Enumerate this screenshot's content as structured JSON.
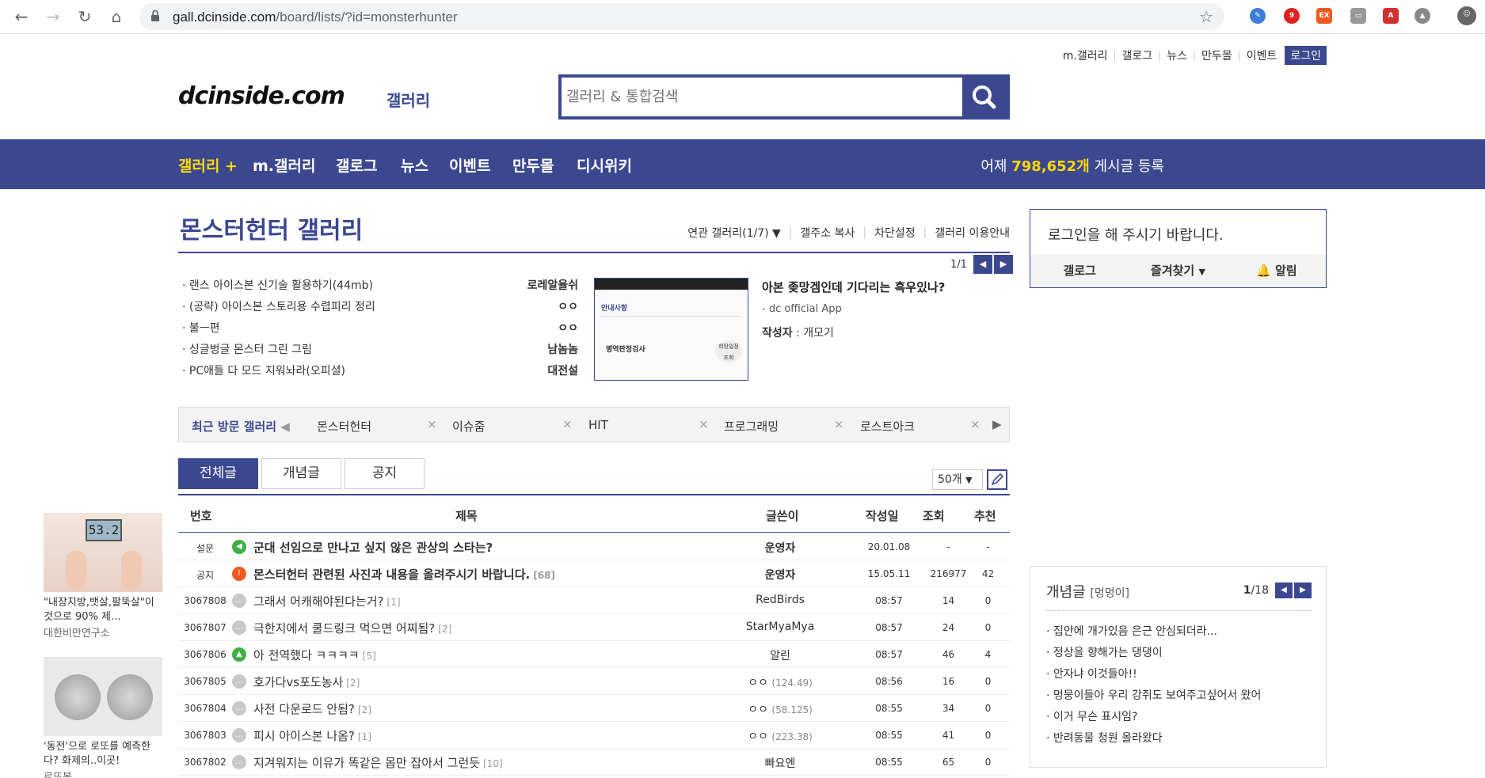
{
  "browser": {
    "url_host": "gall.dcinside.com",
    "url_path": "/board/lists/?id=monsterhunter",
    "ext_badge": "9",
    "ext_ex": "EX"
  },
  "toplinks": [
    "m.갤러리",
    "갤로그",
    "뉴스",
    "만두몰",
    "이벤트"
  ],
  "login_label": "로그인",
  "logo": "dcinside.com",
  "logo_sub": "갤러리",
  "search": {
    "placeholder": "갤러리 & 통합검색"
  },
  "nav": {
    "items": [
      "갤러리 +",
      "m.갤러리",
      "갤로그",
      "뉴스",
      "이벤트",
      "만두몰",
      "디시위키"
    ],
    "stat_prefix": "어제",
    "stat_count": "798,652개",
    "stat_suffix": "게시글 등록"
  },
  "gallery": {
    "title": "몬스터헌터 갤러리",
    "menu": [
      "연관 갤러리(1/7)",
      "갤주소 복사",
      "차단설정",
      "갤러리 이용안내"
    ],
    "page": "1/1"
  },
  "issues": [
    {
      "title": "랜스 아이스본 신기술 활용하기(44mb)",
      "writer": "로레알율쉬"
    },
    {
      "title": "(공략) 아이스본 스토리용 수렵피리 정리",
      "writer": "ㅇㅇ"
    },
    {
      "title": "불ㅡ편",
      "writer": "ㅇㅇ"
    },
    {
      "title": "싱글벙글 몬스터 그린 그림",
      "writer": "남놈놈"
    },
    {
      "title": "PC애들 다 모드 지워놔라(오피셜)",
      "writer": "대전설"
    }
  ],
  "issue_feature": {
    "title": "아본 좆망겜인데 기다리는 흑우있나?",
    "source": "- dc official App",
    "author_label": "작성자",
    "author": "개모기",
    "thumb_notice": "안내사항",
    "thumb_item": "병역판정검사",
    "thumb_btn": "희망일정 조회"
  },
  "recent": {
    "label": "최근 방문 갤러리",
    "galleries": [
      "몬스터헌터",
      "이슈줌",
      "HIT",
      "프로그래밍",
      "로스트아크"
    ]
  },
  "tabs": [
    "전체글",
    "개념글",
    "공지"
  ],
  "per_page": "50개",
  "table": {
    "headers": [
      "번호",
      "제목",
      "글쓴이",
      "작성일",
      "조회",
      "추천"
    ],
    "rows": [
      {
        "num": "설문",
        "title": "군대 선임으로 만나고 싶지 않은 관상의 스타는?",
        "reply": "",
        "writer": "운영자",
        "ip": "",
        "date": "20.01.08",
        "views": "-",
        "rec": "-",
        "icon": "survey",
        "notice": true
      },
      {
        "num": "공지",
        "title": "몬스터헌터 관련된 사진과 내용을 올려주시기 바랍니다.",
        "reply": "[68]",
        "writer": "운영자",
        "ip": "",
        "date": "15.05.11",
        "views": "216977",
        "rec": "42",
        "icon": "notice",
        "notice": true
      },
      {
        "num": "3067808",
        "title": "그래서 어캐해야된다는거?",
        "reply": "[1]",
        "writer": "RedBirds",
        "ip": "",
        "date": "08:57",
        "views": "14",
        "rec": "0",
        "icon": "chat",
        "notice": false
      },
      {
        "num": "3067807",
        "title": "극한지에서 쿨드링크 먹으면 어찌됨?",
        "reply": "[2]",
        "writer": "StarMyaMya",
        "ip": "",
        "date": "08:57",
        "views": "24",
        "rec": "0",
        "icon": "chat",
        "notice": false
      },
      {
        "num": "3067806",
        "title": "아 전역했다 ㅋㅋㅋㅋ",
        "reply": "[5]",
        "writer": "알린",
        "ip": "",
        "date": "08:57",
        "views": "46",
        "rec": "4",
        "icon": "image",
        "notice": false
      },
      {
        "num": "3067805",
        "title": "호가다vs포도농사",
        "reply": "[2]",
        "writer": "ㅇㅇ",
        "ip": "(124.49)",
        "date": "08:56",
        "views": "16",
        "rec": "0",
        "icon": "chat",
        "notice": false
      },
      {
        "num": "3067804",
        "title": "사전 다운로드 안됨?",
        "reply": "[2]",
        "writer": "ㅇㅇ",
        "ip": "(58.125)",
        "date": "08:55",
        "views": "34",
        "rec": "0",
        "icon": "chat",
        "notice": false
      },
      {
        "num": "3067803",
        "title": "피시 아이스본 나옴?",
        "reply": "[1]",
        "writer": "ㅇㅇ",
        "ip": "(223.38)",
        "date": "08:55",
        "views": "41",
        "rec": "0",
        "icon": "chat",
        "notice": false
      },
      {
        "num": "3067802",
        "title": "지겨워지는 이유가 똑같은 몹만 잡아서 그런듯",
        "reply": "[10]",
        "writer": "빠요엔",
        "ip": "",
        "date": "08:55",
        "views": "65",
        "rec": "0",
        "icon": "chat",
        "notice": false
      }
    ]
  },
  "login_box": {
    "message": "로그인을 해 주시기 바랍니다.",
    "buttons": [
      "갤로그",
      "즐겨찾기",
      "알림"
    ]
  },
  "concept_box": {
    "title": "개념글",
    "sub": "[멍멍이]",
    "page_cur": "1",
    "page_total": "/18",
    "items": [
      "집안에 개가있음 은근 안심되더라...",
      "정상을 향해가는 댕댕이",
      "안자냐 이것들아!!",
      "멍뭉이들아 우리 강쥐도 보여주고싶어서 왔어",
      "이거 무슨 표시임?",
      "반려동물 청원 올라왔다"
    ]
  },
  "ads": [
    {
      "scale_text": "53.2",
      "caption": "\"내장지방,뱃살,팔뚝살\"이것으로 90% 제...",
      "source": "대한비만연구소"
    },
    {
      "caption": "'동전'으로 로또를 예측한다? 화제의..이곳!",
      "source": "로또복"
    }
  ],
  "colors": {
    "brand": "#3b4890",
    "accent": "#ffd800"
  }
}
